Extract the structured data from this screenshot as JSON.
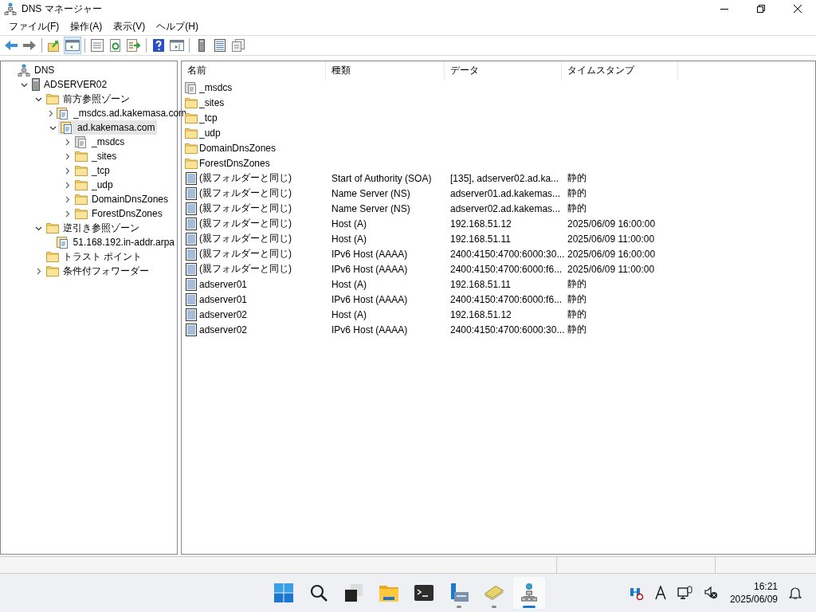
{
  "window": {
    "title": "DNS マネージャー"
  },
  "menu": [
    "ファイル(F)",
    "操作(A)",
    "表示(V)",
    "ヘルプ(H)"
  ],
  "toolbar": [
    [
      {
        "kind": "back",
        "selected": false
      },
      {
        "kind": "forward",
        "selected": false
      }
    ],
    [
      {
        "kind": "up",
        "selected": false
      },
      {
        "kind": "tree",
        "selected": true
      }
    ],
    [
      {
        "kind": "props",
        "selected": false
      },
      {
        "kind": "refresh",
        "selected": false
      },
      {
        "kind": "export",
        "selected": false
      }
    ],
    [
      {
        "kind": "help",
        "selected": false
      },
      {
        "kind": "pane",
        "selected": false
      }
    ],
    [
      {
        "kind": "server",
        "selected": false
      },
      {
        "kind": "list",
        "selected": false
      },
      {
        "kind": "copy",
        "selected": false
      }
    ]
  ],
  "tree": [
    {
      "label": "DNS",
      "kind": "dns",
      "expander": false,
      "selected": false,
      "children": [
        {
          "label": "ADSERVER02",
          "kind": "server",
          "expander": true,
          "expanded": true,
          "selected": false,
          "children": [
            {
              "label": "前方参照ゾーン",
              "kind": "folder",
              "expander": true,
              "expanded": true,
              "selected": false,
              "children": [
                {
                  "label": "_msdcs.ad.kakemasa.com",
                  "kind": "zone",
                  "expander": true,
                  "expanded": false,
                  "selected": false
                },
                {
                  "label": "ad.kakemasa.com",
                  "kind": "zone",
                  "expander": true,
                  "expanded": true,
                  "selected": true,
                  "children": [
                    {
                      "label": "_msdcs",
                      "kind": "delegation",
                      "expander": true,
                      "expanded": false,
                      "selected": false
                    },
                    {
                      "label": "_sites",
                      "kind": "folder",
                      "expander": true,
                      "expanded": false,
                      "selected": false
                    },
                    {
                      "label": "_tcp",
                      "kind": "folder",
                      "expander": true,
                      "expanded": false,
                      "selected": false
                    },
                    {
                      "label": "_udp",
                      "kind": "folder",
                      "expander": true,
                      "expanded": false,
                      "selected": false
                    },
                    {
                      "label": "DomainDnsZones",
                      "kind": "folder",
                      "expander": true,
                      "expanded": false,
                      "selected": false
                    },
                    {
                      "label": "ForestDnsZones",
                      "kind": "folder",
                      "expander": true,
                      "expanded": false,
                      "selected": false
                    }
                  ]
                }
              ]
            },
            {
              "label": "逆引き参照ゾーン",
              "kind": "folder",
              "expander": true,
              "expanded": true,
              "selected": false,
              "children": [
                {
                  "label": "51.168.192.in-addr.arpa",
                  "kind": "zone",
                  "expander": false,
                  "selected": false
                }
              ]
            },
            {
              "label": "トラスト ポイント",
              "kind": "folder",
              "expander": false,
              "selected": false
            },
            {
              "label": "条件付フォワーダー",
              "kind": "folder",
              "expander": true,
              "expanded": false,
              "selected": false
            }
          ]
        }
      ]
    }
  ],
  "table": {
    "columns": [
      "名前",
      "種類",
      "データ",
      "タイムスタンプ"
    ],
    "rows": [
      {
        "kind": "delegation",
        "name": "_msdcs"
      },
      {
        "kind": "folder",
        "name": "_sites"
      },
      {
        "kind": "folder",
        "name": "_tcp"
      },
      {
        "kind": "folder",
        "name": "_udp"
      },
      {
        "kind": "folder",
        "name": "DomainDnsZones"
      },
      {
        "kind": "folder",
        "name": "ForestDnsZones"
      },
      {
        "kind": "record",
        "name": "(親フォルダーと同じ)",
        "type": "Start of Authority (SOA)",
        "data": "[135], adserver02.ad.ka...",
        "timestamp": "静的"
      },
      {
        "kind": "record",
        "name": "(親フォルダーと同じ)",
        "type": "Name Server (NS)",
        "data": "adserver01.ad.kakemas...",
        "timestamp": "静的"
      },
      {
        "kind": "record",
        "name": "(親フォルダーと同じ)",
        "type": "Name Server (NS)",
        "data": "adserver02.ad.kakemas...",
        "timestamp": "静的"
      },
      {
        "kind": "record",
        "name": "(親フォルダーと同じ)",
        "type": "Host (A)",
        "data": "192.168.51.12",
        "timestamp": "2025/06/09 16:00:00"
      },
      {
        "kind": "record",
        "name": "(親フォルダーと同じ)",
        "type": "Host (A)",
        "data": "192.168.51.11",
        "timestamp": "2025/06/09 11:00:00"
      },
      {
        "kind": "record",
        "name": "(親フォルダーと同じ)",
        "type": "IPv6 Host (AAAA)",
        "data": "2400:4150:4700:6000:30...",
        "timestamp": "2025/06/09 16:00:00"
      },
      {
        "kind": "record",
        "name": "(親フォルダーと同じ)",
        "type": "IPv6 Host (AAAA)",
        "data": "2400:4150:4700:6000:f6...",
        "timestamp": "2025/06/09 11:00:00"
      },
      {
        "kind": "record",
        "name": "adserver01",
        "type": "Host (A)",
        "data": "192.168.51.11",
        "timestamp": "静的"
      },
      {
        "kind": "record",
        "name": "adserver01",
        "type": "IPv6 Host (AAAA)",
        "data": "2400:4150:4700:6000:f6...",
        "timestamp": "静的"
      },
      {
        "kind": "record",
        "name": "adserver02",
        "type": "Host (A)",
        "data": "192.168.51.12",
        "timestamp": "静的"
      },
      {
        "kind": "record",
        "name": "adserver02",
        "type": "IPv6 Host (AAAA)",
        "data": "2400:4150:4700:6000:30...",
        "timestamp": "静的"
      }
    ]
  },
  "taskbar": {
    "apps": [
      {
        "kind": "start",
        "running": false,
        "active": false
      },
      {
        "kind": "search",
        "running": false,
        "active": false
      },
      {
        "kind": "taskview",
        "running": false,
        "active": false
      },
      {
        "kind": "explorer",
        "running": false,
        "active": false
      },
      {
        "kind": "terminal",
        "running": false,
        "active": false
      },
      {
        "kind": "servermanager",
        "running": true,
        "active": false
      },
      {
        "kind": "cards",
        "running": true,
        "active": false
      },
      {
        "kind": "dns",
        "running": true,
        "active": true
      }
    ],
    "time": "16:21",
    "date": "2025/06/09"
  }
}
